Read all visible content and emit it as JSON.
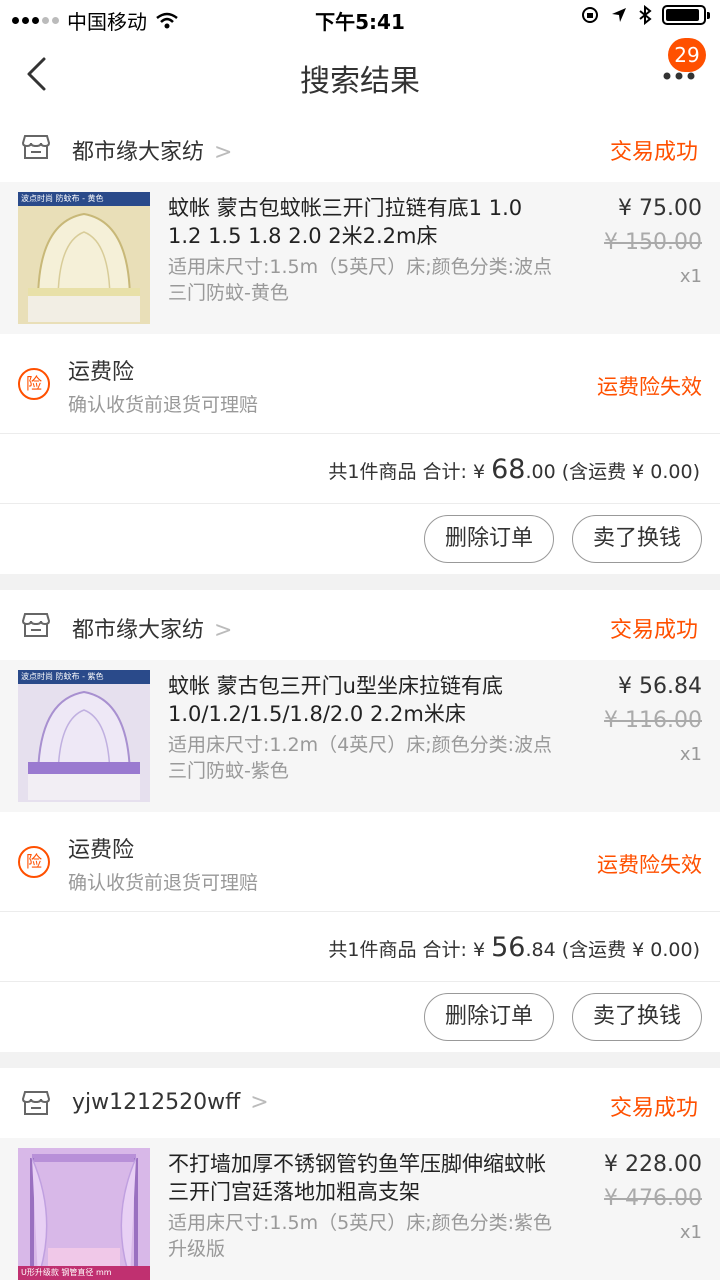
{
  "status_bar": {
    "carrier": "中国移动",
    "time": "下午5:41"
  },
  "nav": {
    "title": "搜索结果",
    "badge_count": "29"
  },
  "orders": [
    {
      "shop_name": "都市缘大家纺",
      "status": "交易成功",
      "thumb_label": "波点时尚 防蚊布 - 黄色",
      "thumb_color": "#e9dfb8",
      "item_title": "蚊帐 蒙古包蚊帐三开门拉链有底1 1.0 1.2 1.5 1.8 2.0 2米2.2m床",
      "item_spec": "适用床尺寸:1.5m（5英尺）床;颜色分类:波点三门防蚊-黄色",
      "price": "¥ 75.00",
      "orig_price": "¥ 150.00",
      "qty": "x1",
      "insurance_title": "运费险",
      "insurance_sub": "确认收货前退货可理赔",
      "insurance_status": "运费险失效",
      "insurance_icon": "险",
      "summary_prefix": "共1件商品 合计: ¥ ",
      "summary_big": "68",
      "summary_small": ".00",
      "summary_suffix": " (含运费 ¥ 0.00)",
      "btn_delete": "删除订单",
      "btn_sell": "卖了换钱"
    },
    {
      "shop_name": "都市缘大家纺",
      "status": "交易成功",
      "thumb_label": "波点时尚 防蚊布 - 紫色",
      "thumb_color": "#d9cfee",
      "item_title": "蚊帐 蒙古包三开门u型坐床拉链有底 1.0/1.2/1.5/1.8/2.0 2.2m米床",
      "item_spec": "适用床尺寸:1.2m（4英尺）床;颜色分类:波点三门防蚊-紫色",
      "price": "¥ 56.84",
      "orig_price": "¥ 116.00",
      "qty": "x1",
      "insurance_title": "运费险",
      "insurance_sub": "确认收货前退货可理赔",
      "insurance_status": "运费险失效",
      "insurance_icon": "险",
      "summary_prefix": "共1件商品 合计: ¥ ",
      "summary_big": "56",
      "summary_small": ".84",
      "summary_suffix": " (含运费 ¥ 0.00)",
      "btn_delete": "删除订单",
      "btn_sell": "卖了换钱"
    },
    {
      "shop_name": "yjw1212520wff",
      "status": "交易成功",
      "thumb_label": "U形升级款 钢管直径 mm",
      "thumb_color": "#d8b8e8",
      "item_title": "不打墙加厚不锈钢管钓鱼竿压脚伸缩蚊帐三开门宫廷落地加粗高支架",
      "item_spec": "适用床尺寸:1.5m（5英尺）床;颜色分类:紫色升级版",
      "price": "¥ 228.00",
      "orig_price": "¥ 476.00",
      "qty": "x1"
    }
  ]
}
